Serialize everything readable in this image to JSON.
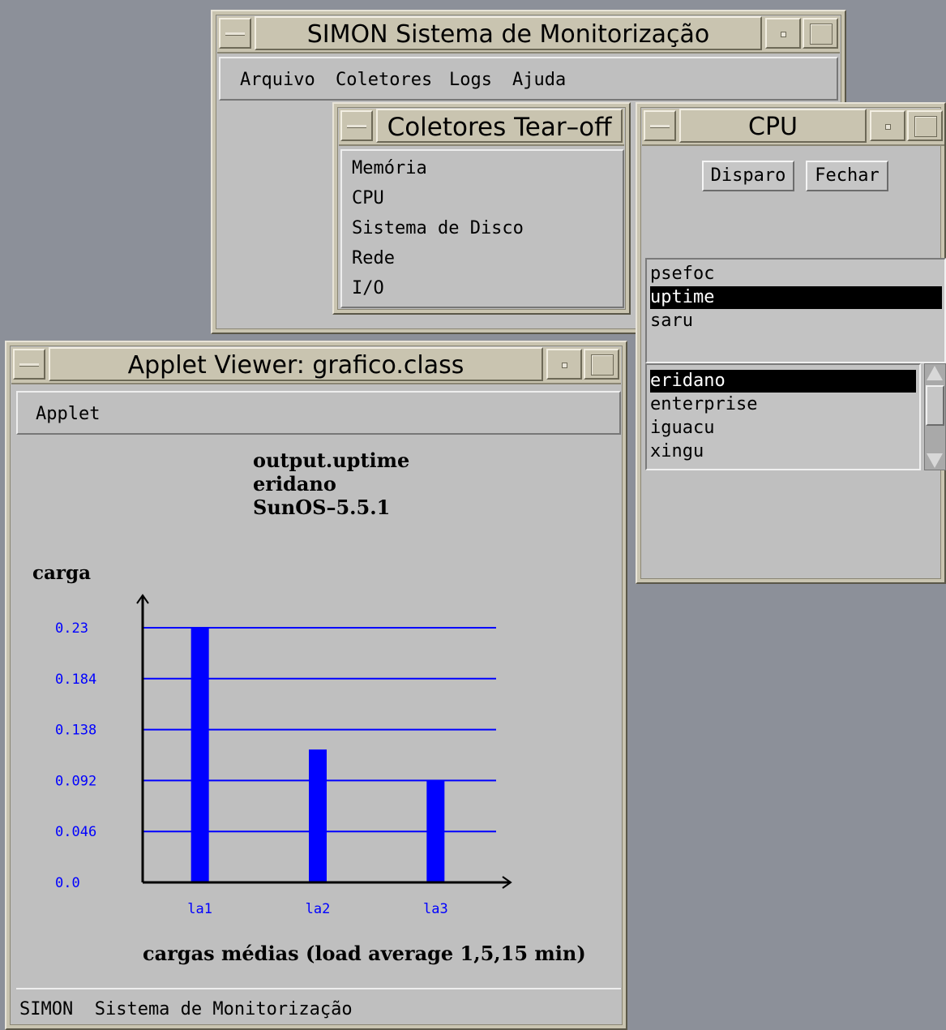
{
  "main_window": {
    "title": "SIMON Sistema de Monitorização",
    "menu": [
      "Arquivo",
      "Coletores",
      "Logs",
      "Ajuda"
    ]
  },
  "tearoff_window": {
    "title": "Coletores Tear–off",
    "items": [
      "Memória",
      "CPU",
      "Sistema de Disco",
      "Rede",
      "I/O"
    ]
  },
  "cpu_window": {
    "title": "CPU",
    "buttons": {
      "trigger": "Disparo",
      "close": "Fechar"
    },
    "commands": [
      "psefoc",
      "uptime",
      "saru"
    ],
    "selected_command": "uptime",
    "hosts": [
      "eridano",
      "enterprise",
      "iguacu",
      "xingu"
    ],
    "selected_host": "eridano"
  },
  "applet_window": {
    "title": "Applet Viewer: grafico.class",
    "menu": [
      "Applet"
    ],
    "status": "SIMON  Sistema de Monitorização"
  },
  "chart_data": {
    "type": "bar",
    "title_lines": [
      "output.uptime",
      "eridano",
      "SunOS–5.5.1"
    ],
    "ylabel": "carga",
    "xlabel": "cargas médias (load average 1,5,15 min)",
    "categories": [
      "la1",
      "la2",
      "la3"
    ],
    "values": [
      0.23,
      0.12,
      0.092
    ],
    "ylim": [
      0,
      0.23
    ],
    "yticks": [
      "0.0",
      "0.046",
      "0.092",
      "0.138",
      "0.184",
      "0.23"
    ],
    "ytick_values": [
      0,
      0.046,
      0.092,
      0.138,
      0.184,
      0.23
    ],
    "grid": true,
    "bar_color": "#0000ff",
    "tick_color": "#0000ff",
    "grid_color": "#0000ff"
  }
}
